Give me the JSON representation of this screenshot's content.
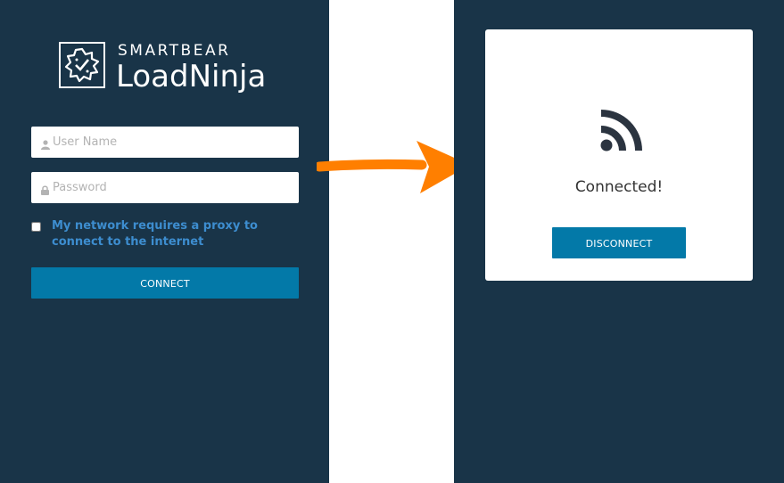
{
  "logo": {
    "brand": "SMARTBEAR",
    "product": "LoadNinja",
    "icon": "loadninja-logo-icon"
  },
  "login_form": {
    "username": {
      "placeholder": "User Name",
      "value": "",
      "icon": "user-icon"
    },
    "password": {
      "placeholder": "Password",
      "value": "",
      "icon": "lock-icon"
    },
    "proxy_label": "My network requires a proxy to connect to the internet",
    "proxy_checked": false,
    "connect_label": "CONNECT"
  },
  "arrow": {
    "icon": "right-arrow-icon",
    "color": "#ff7f00"
  },
  "connected_card": {
    "icon": "rss-feed-icon",
    "status": "Connected!",
    "disconnect_label": "DISCONNECT"
  },
  "colors": {
    "panel_bg": "#193448",
    "button": "#0379a8",
    "link": "#3d8dcf",
    "arrow": "#ff7f00"
  }
}
